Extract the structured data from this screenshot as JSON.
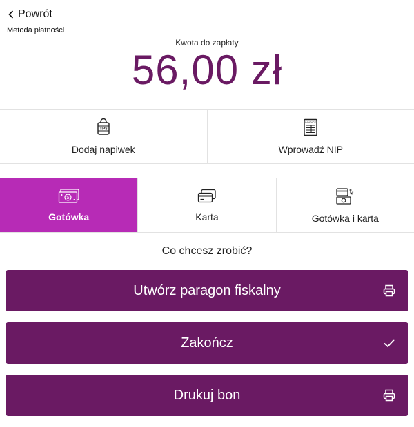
{
  "header": {
    "back_label": "Powrót",
    "title": "Metoda płatności"
  },
  "amount": {
    "label": "Kwota do zapłaty",
    "value": "56,00 zł"
  },
  "extras": [
    {
      "label": "Dodaj napiwek",
      "icon": "tips-bag-icon",
      "icon_text": "TIPS"
    },
    {
      "label": "Wprowadź NIP",
      "icon": "invoice-icon",
      "icon_text": "INVOICE"
    }
  ],
  "methods": [
    {
      "label": "Gotówka",
      "icon": "cash-icon",
      "selected": true
    },
    {
      "label": "Karta",
      "icon": "card-icon",
      "selected": false
    },
    {
      "label": "Gotówka i karta",
      "icon": "cash-and-card-icon",
      "selected": false
    }
  ],
  "prompt": "Co chcesz zrobić?",
  "actions": [
    {
      "label": "Utwórz paragon fiskalny",
      "icon": "printer-icon"
    },
    {
      "label": "Zakończ",
      "icon": "checkmark-icon"
    },
    {
      "label": "Drukuj bon",
      "icon": "printer-icon"
    }
  ],
  "colors": {
    "brand": "#6a1a63",
    "selected_method": "#b72bb6",
    "divider": "#e2e2e2"
  }
}
